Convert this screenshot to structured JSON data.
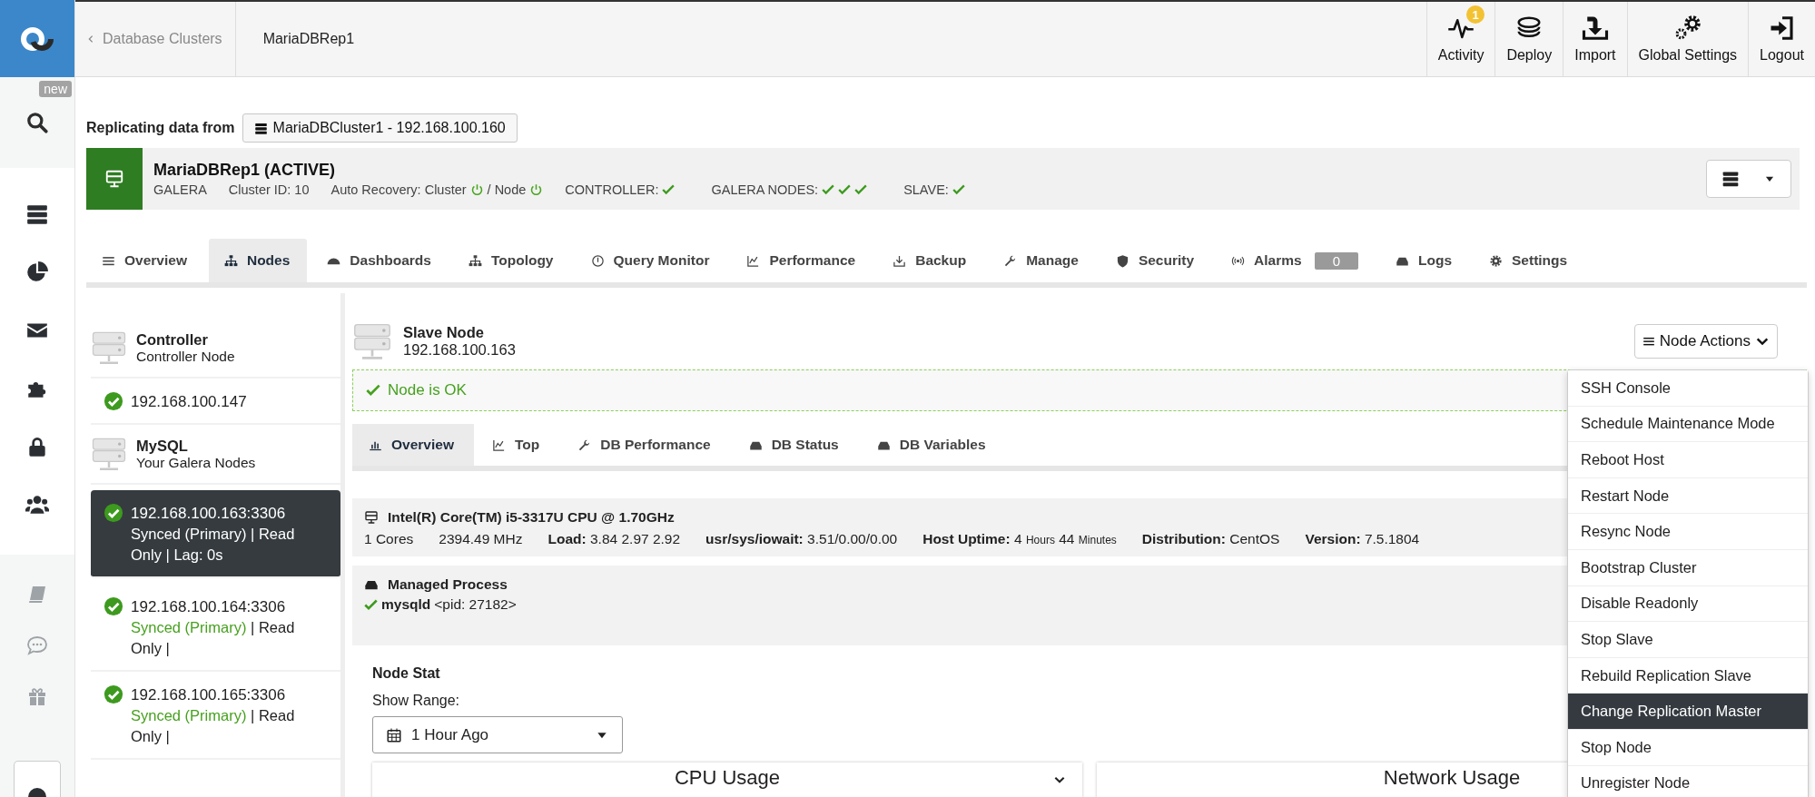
{
  "rail": {
    "badge": "new"
  },
  "header": {
    "breadcrumb": "Database Clusters",
    "title": "MariaDBRep1",
    "actions": [
      {
        "label": "Activity",
        "badge": "1"
      },
      {
        "label": "Deploy"
      },
      {
        "label": "Import"
      },
      {
        "label": "Global Settings"
      },
      {
        "label": "Logout"
      }
    ]
  },
  "replication": {
    "label": "Replicating data from",
    "source": "MariaDBCluster1 - 192.168.100.160"
  },
  "cluster": {
    "name": "MariaDBRep1 (ACTIVE)",
    "type": "GALERA",
    "cluster_id": "Cluster ID: 10",
    "auto_recovery_label": "Auto Recovery: Cluster",
    "cluster_recovery_on": true,
    "node_label": "/ Node",
    "node_recovery_on": true,
    "statuses": [
      {
        "label": "CONTROLLER:",
        "checks": [
          {
            "ok": true
          }
        ]
      },
      {
        "label": "GALERA NODES:",
        "checks": [
          {
            "ok": true
          },
          {
            "ok": true
          },
          {
            "ok": true
          }
        ]
      },
      {
        "label": "SLAVE:",
        "checks": [
          {
            "ok": true
          }
        ]
      }
    ]
  },
  "tabs": [
    {
      "label": "Overview",
      "selected": false
    },
    {
      "label": "Nodes",
      "selected": true
    },
    {
      "label": "Dashboards",
      "selected": false
    },
    {
      "label": "Topology",
      "selected": false
    },
    {
      "label": "Query Monitor",
      "selected": false
    },
    {
      "label": "Performance",
      "selected": false
    },
    {
      "label": "Backup",
      "selected": false
    },
    {
      "label": "Manage",
      "selected": false
    },
    {
      "label": "Security",
      "selected": false
    },
    {
      "label": "Alarms",
      "selected": false,
      "count": "0"
    },
    {
      "label": "Logs",
      "selected": false
    },
    {
      "label": "Settings",
      "selected": false
    }
  ],
  "node_list": [
    {
      "kind": "group",
      "title": "Controller",
      "subtitle": "Controller Node"
    },
    {
      "kind": "node",
      "address": "192.168.100.147",
      "ok": true,
      "selected": false
    },
    {
      "kind": "group",
      "title": "MySQL",
      "subtitle": "Your Galera Nodes"
    },
    {
      "kind": "node",
      "address": "192.168.100.163:3306",
      "ok": true,
      "status": "Synced (Primary)",
      "detail": " | Read Only | Lag: 0s",
      "selected": true
    },
    {
      "kind": "node",
      "address": "192.168.100.164:3306",
      "ok": true,
      "status": "Synced (Primary)",
      "detail": " | Read Only |",
      "selected": false
    },
    {
      "kind": "node",
      "address": "192.168.100.165:3306",
      "ok": true,
      "status": "Synced (Primary)",
      "detail": " | Read Only |",
      "selected": false
    }
  ],
  "panel": {
    "title": "Slave Node",
    "address": "192.168.100.163",
    "alert": {
      "text": "Node is OK",
      "ok": true
    },
    "sub_tabs": [
      {
        "label": "Overview",
        "selected": true
      },
      {
        "label": "Top",
        "selected": false
      },
      {
        "label": "DB Performance",
        "selected": false
      },
      {
        "label": "DB Status",
        "selected": false
      },
      {
        "label": "DB Variables",
        "selected": false
      }
    ],
    "host": {
      "cpu": "Intel(R) Core(TM) i5-3317U CPU @ 1.70GHz",
      "stats": [
        {
          "text": "1 Cores"
        },
        {
          "text": "2394.49 MHz"
        },
        {
          "text": "**Load:** 3.84 2.97 2.92"
        },
        {
          "text": "**usr/sys/iowait:** 3.51/0.00/0.00"
        },
        {
          "label": "Host Uptime:",
          "parts": [
            {
              "kind": "number",
              "text": "4"
            },
            {
              "kind": "unit",
              "text": "Hours"
            },
            {
              "kind": "number",
              "text": "44"
            },
            {
              "kind": "unit",
              "text": "Minutes"
            }
          ]
        },
        {
          "text": "**Distribution:** CentOS"
        },
        {
          "text": "**Version:** 7.5.1804"
        }
      ]
    },
    "managed_process": {
      "title": "Managed Process",
      "processes": [
        {
          "name": "mysqld",
          "pid": "<pid: 27182>",
          "ok": true
        }
      ]
    },
    "node_stat": {
      "title": "Node Stat",
      "range_label": "Show Range:",
      "range_value": "1 Hour Ago"
    },
    "charts": [
      {
        "title": "CPU Usage"
      },
      {
        "title": "Network Usage"
      }
    ],
    "node_actions": {
      "label": "Node Actions",
      "items": [
        {
          "label": "SSH Console",
          "selected": false
        },
        {
          "label": "Schedule Maintenance Mode",
          "selected": false
        },
        {
          "label": "Reboot Host",
          "selected": false
        },
        {
          "label": "Restart Node",
          "selected": false
        },
        {
          "label": "Resync Node",
          "selected": false
        },
        {
          "label": "Bootstrap Cluster",
          "selected": false
        },
        {
          "label": "Disable Readonly",
          "selected": false
        },
        {
          "label": "Stop Slave",
          "selected": false
        },
        {
          "label": "Rebuild Replication Slave",
          "selected": false
        },
        {
          "label": "Change Replication Master",
          "selected": true
        },
        {
          "label": "Stop Node",
          "selected": false
        },
        {
          "label": "Unregister Node",
          "selected": false
        }
      ]
    }
  }
}
